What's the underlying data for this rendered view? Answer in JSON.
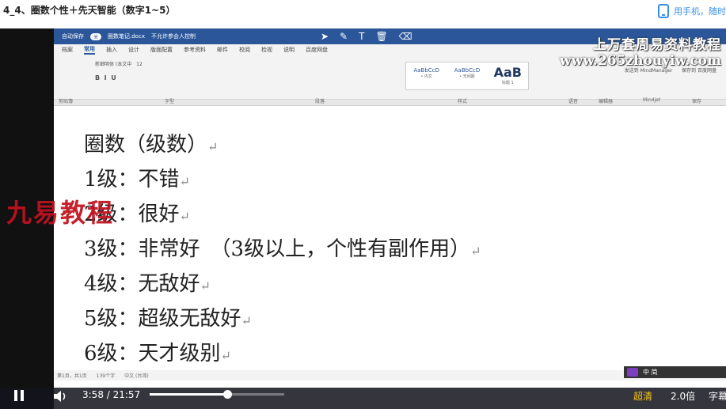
{
  "page": {
    "title": "4_4、圈数个性＋先天智能（数字1~5）",
    "mobile_hint": "用手机，随时"
  },
  "word": {
    "autosave": "自动保存",
    "toggle": "关",
    "doc_name": "圈数笔记.docx",
    "edit_restrict": "不允许参会人控制",
    "tabs": [
      "档案",
      "常用",
      "插入",
      "设计",
      "版面配置",
      "参考资料",
      "邮件",
      "校阅",
      "检视",
      "说明",
      "百度网盘"
    ],
    "active_tab": "常用",
    "font_name": "新细明体 (本文中",
    "font_size": "12",
    "styles": [
      "AaBbCcD",
      "AaBbCcD",
      "AaB"
    ],
    "style_names": [
      "• 内文",
      "• 无间距",
      "标题 1"
    ],
    "group_labels": [
      "剪贴簿",
      "字型",
      "段落",
      "样式",
      "语音",
      "编辑器",
      "Mindjet",
      "保存"
    ],
    "right_labels": [
      "发送到 MindManager",
      "保存到 百度网盘"
    ],
    "share": "共用",
    "comments": "注解"
  },
  "document": {
    "lines": [
      "圈数（级数）",
      "1级：不错",
      "2级：很好",
      "3级：非常好　（3级以上，个性有副作用）",
      "4级：无敌好",
      "5级：超级无敌好",
      "6级：天才级别"
    ],
    "para_mark": "↵"
  },
  "watermarks": {
    "left_red": "九易教程",
    "top_right_1": "上万套周易资料教程",
    "top_right_2": "www.265zhouyiw.com"
  },
  "status": {
    "items": [
      "第1页，共1页",
      "139个字",
      "中文 (台湾)"
    ]
  },
  "ime": {
    "text": "中  简"
  },
  "player": {
    "current_time": "3:58",
    "total_time": "21:57",
    "time_text": "3:58 / 21:57",
    "progress_fraction": 0.181,
    "quality": "超清",
    "speed": "2.0倍",
    "subtitle": "字幕"
  }
}
